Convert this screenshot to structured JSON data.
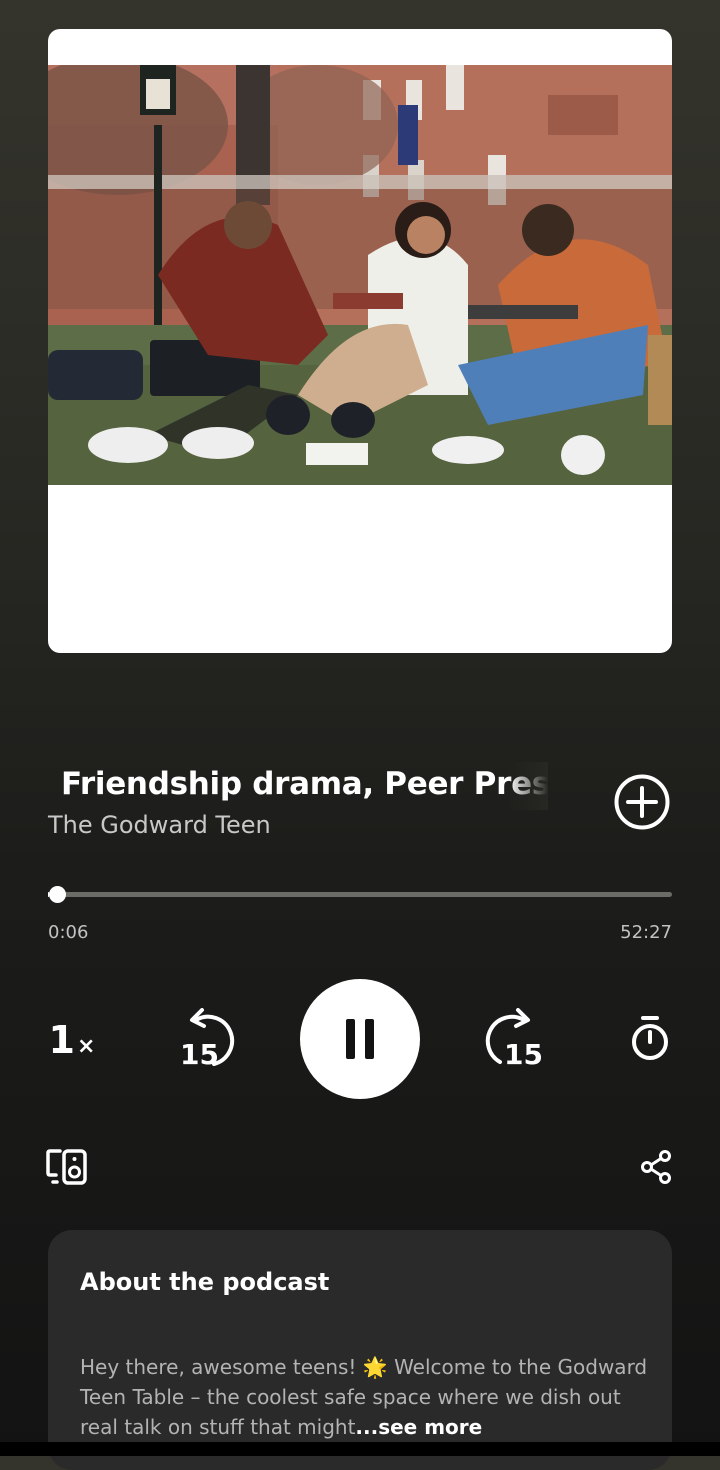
{
  "episode": {
    "title": "Friendship drama, Peer Pressure",
    "show": "The Godward Teen"
  },
  "playback": {
    "progress_fraction": 0.002,
    "elapsed": "0:06",
    "duration": "52:27",
    "speed_value": "1",
    "speed_suffix": "×",
    "skip_back_label": "15",
    "skip_forward_label": "15"
  },
  "about": {
    "title": "About the podcast",
    "description": "Hey there, awesome teens! 🌟 Welcome to the Godward Teen Table – the coolest safe space where we dish out real talk on stuff that might",
    "see_more": "...see more"
  },
  "icons": {
    "add": "add-circle-icon",
    "skip_back": "rewind-15-icon",
    "pause": "pause-icon",
    "skip_forward": "forward-15-icon",
    "timer": "sleep-timer-icon",
    "devices": "connect-device-icon",
    "share": "share-icon"
  },
  "colors": {
    "background_top": "#34342c",
    "background_bottom": "#131313",
    "card": "#2a2a2a",
    "accent": "#ffffff"
  }
}
